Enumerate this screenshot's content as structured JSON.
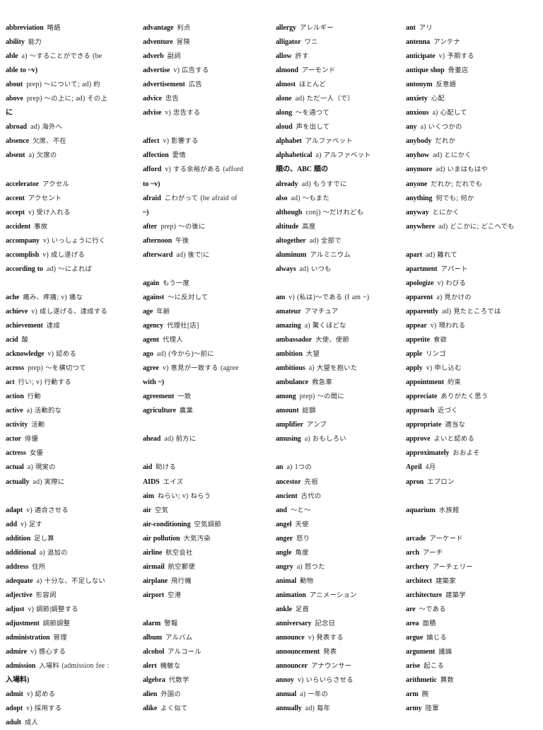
{
  "document": {
    "title": "English-Japanese Vocabulary List",
    "page_kind": "scanned-dictionary-page",
    "column_count": 4
  },
  "columns": [
    {
      "id": "column-1",
      "entries": [
        {
          "headword": "abbreviation",
          "gloss": "略語"
        },
        {
          "headword": "ability",
          "gloss": "能力"
        },
        {
          "headword": "able",
          "gloss": "a) ～することができる (be"
        },
        {
          "headword": "able to ~v)",
          "gloss": ""
        },
        {
          "headword": "about",
          "gloss": "prep) ～について; ad) 約"
        },
        {
          "headword": "above",
          "gloss": "prep) ～の上に; ad) その上"
        },
        {
          "headword": "に",
          "gloss": ""
        },
        {
          "headword": "abroad",
          "gloss": "ad) 海外へ"
        },
        {
          "headword": "absence",
          "gloss": "欠席、不在"
        },
        {
          "headword": "absent",
          "gloss": "a) 欠席の"
        },
        {
          "headword": "",
          "gloss": ""
        },
        {
          "headword": "accelerator",
          "gloss": "アクセル"
        },
        {
          "headword": "accent",
          "gloss": "アクセント"
        },
        {
          "headword": "accept",
          "gloss": "v) 受け入れる"
        },
        {
          "headword": "accident",
          "gloss": "事故"
        },
        {
          "headword": "accompany",
          "gloss": "v) いっしょうに行く"
        },
        {
          "headword": "accomplish",
          "gloss": "v) 成し遂げる"
        },
        {
          "headword": "according to",
          "gloss": "ad) ～によれば"
        },
        {
          "headword": "",
          "gloss": ""
        },
        {
          "headword": "ache",
          "gloss": "痛み、疼痛; v) 痛な"
        },
        {
          "headword": "achieve",
          "gloss": "v) 成し遂げる、達成する"
        },
        {
          "headword": "achievement",
          "gloss": "達成"
        },
        {
          "headword": "acid",
          "gloss": "酸"
        },
        {
          "headword": "acknowledge",
          "gloss": "v) 認める"
        },
        {
          "headword": "across",
          "gloss": "prep) ～を横切つて"
        },
        {
          "headword": "act",
          "gloss": "行い; v) 行動する"
        },
        {
          "headword": "action",
          "gloss": "行動"
        },
        {
          "headword": "active",
          "gloss": "a) 活動的な"
        },
        {
          "headword": "activity",
          "gloss": "活動"
        },
        {
          "headword": "actor",
          "gloss": "俳優"
        },
        {
          "headword": "actress",
          "gloss": "女優"
        },
        {
          "headword": "actual",
          "gloss": "a) 現実の"
        },
        {
          "headword": "actually",
          "gloss": "ad) 実際に"
        },
        {
          "headword": "",
          "gloss": ""
        },
        {
          "headword": "adapt",
          "gloss": "v) 適合させる"
        },
        {
          "headword": "add",
          "gloss": "v) 足す"
        },
        {
          "headword": "addition",
          "gloss": "足し算"
        },
        {
          "headword": "additional",
          "gloss": "a) 追加の"
        },
        {
          "headword": "address",
          "gloss": "住所"
        },
        {
          "headword": "adequate",
          "gloss": "a) 十分な、不足しない"
        },
        {
          "headword": "adjective",
          "gloss": "形容詞"
        },
        {
          "headword": "adjust",
          "gloss": "v) 調節|調整する"
        },
        {
          "headword": "adjustment",
          "gloss": "調節調整"
        },
        {
          "headword": "administration",
          "gloss": "管理"
        },
        {
          "headword": "admire",
          "gloss": "v) 感心する"
        },
        {
          "headword": "admission",
          "gloss": "入場料 (admission fee :"
        },
        {
          "headword": "入場料)",
          "gloss": ""
        },
        {
          "headword": "admit",
          "gloss": "v) 認める"
        },
        {
          "headword": "adopt",
          "gloss": "v) 採用する"
        },
        {
          "headword": "adult",
          "gloss": "成人"
        }
      ]
    },
    {
      "id": "column-2",
      "entries": [
        {
          "headword": "advantage",
          "gloss": "利点"
        },
        {
          "headword": "adventure",
          "gloss": "冒険"
        },
        {
          "headword": "adverb",
          "gloss": "副詞"
        },
        {
          "headword": "advertise",
          "gloss": "v) 広告する"
        },
        {
          "headword": "advertisement",
          "gloss": "広告"
        },
        {
          "headword": "advice",
          "gloss": "忠告"
        },
        {
          "headword": "advise",
          "gloss": "v) 忠告する"
        },
        {
          "headword": "",
          "gloss": ""
        },
        {
          "headword": "affect",
          "gloss": "v) 影響する"
        },
        {
          "headword": "affection",
          "gloss": "愛情"
        },
        {
          "headword": "afford",
          "gloss": "v) する余裕がある (afford"
        },
        {
          "headword": "to ~v)",
          "gloss": ""
        },
        {
          "headword": "afraid",
          "gloss": "こわがって (be afraid of"
        },
        {
          "headword": "~)",
          "gloss": ""
        },
        {
          "headword": "after",
          "gloss": "prep) ～の後に"
        },
        {
          "headword": "afternoon",
          "gloss": "午後"
        },
        {
          "headword": "afterward",
          "gloss": "ad) 後で|に"
        },
        {
          "headword": "",
          "gloss": ""
        },
        {
          "headword": "again",
          "gloss": "もう一度"
        },
        {
          "headword": "against",
          "gloss": "～に反対して"
        },
        {
          "headword": "age",
          "gloss": "年齢"
        },
        {
          "headword": "agency",
          "gloss": "代理社[店]"
        },
        {
          "headword": "agent",
          "gloss": "代理人"
        },
        {
          "headword": "ago",
          "gloss": "ad) (今から)～前に"
        },
        {
          "headword": "agree",
          "gloss": "v) 意見が一致する (agree"
        },
        {
          "headword": "with ~)",
          "gloss": ""
        },
        {
          "headword": "agreement",
          "gloss": "一致"
        },
        {
          "headword": "agriculture",
          "gloss": "農業"
        },
        {
          "headword": "",
          "gloss": ""
        },
        {
          "headword": "ahead",
          "gloss": "ad) 前方に"
        },
        {
          "headword": "",
          "gloss": ""
        },
        {
          "headword": "aid",
          "gloss": "助ける"
        },
        {
          "headword": "AIDS",
          "gloss": "エイズ"
        },
        {
          "headword": "aim",
          "gloss": "ねらい; v) ねらう"
        },
        {
          "headword": "air",
          "gloss": "空気"
        },
        {
          "headword": "air-conditioning",
          "gloss": "空気調節"
        },
        {
          "headword": "air pollution",
          "gloss": "大気汚染"
        },
        {
          "headword": "airline",
          "gloss": "航空会社"
        },
        {
          "headword": "airmail",
          "gloss": "航空郵便"
        },
        {
          "headword": "airplane",
          "gloss": "飛行機"
        },
        {
          "headword": "airport",
          "gloss": "空港"
        },
        {
          "headword": "",
          "gloss": ""
        },
        {
          "headword": "alarm",
          "gloss": "警報"
        },
        {
          "headword": "album",
          "gloss": "アルバム"
        },
        {
          "headword": "alcohol",
          "gloss": "アルコール"
        },
        {
          "headword": "alert",
          "gloss": "機敏な"
        },
        {
          "headword": "algebra",
          "gloss": "代数学"
        },
        {
          "headword": "alien",
          "gloss": "外国の"
        },
        {
          "headword": "alike",
          "gloss": "よく似て"
        }
      ]
    },
    {
      "id": "column-3",
      "entries": [
        {
          "headword": "allergy",
          "gloss": "アレルギー"
        },
        {
          "headword": "alligator",
          "gloss": "ワニ"
        },
        {
          "headword": "allow",
          "gloss": "許す"
        },
        {
          "headword": "almond",
          "gloss": "アーモンド"
        },
        {
          "headword": "almost",
          "gloss": "ほとんど"
        },
        {
          "headword": "alone",
          "gloss": "ad) ただ一人（で）"
        },
        {
          "headword": "along",
          "gloss": "～を通つて"
        },
        {
          "headword": "aloud",
          "gloss": "声を出して"
        },
        {
          "headword": "alphabet",
          "gloss": "アルファベット"
        },
        {
          "headword": "alphabetical",
          "gloss": "a) アルファベット"
        },
        {
          "headword": "順の、ABC 順の",
          "gloss": ""
        },
        {
          "headword": "already",
          "gloss": "ad) もうすでに"
        },
        {
          "headword": "also",
          "gloss": "ad) ～もまた"
        },
        {
          "headword": "although",
          "gloss": "conj) ～だけれども"
        },
        {
          "headword": "altitude",
          "gloss": "高度"
        },
        {
          "headword": "altogether",
          "gloss": "ad) 全部で"
        },
        {
          "headword": "aluminum",
          "gloss": "アルミニウム"
        },
        {
          "headword": "always",
          "gloss": "ad) いつも"
        },
        {
          "headword": "",
          "gloss": ""
        },
        {
          "headword": "am",
          "gloss": "v) (私は)～である (I am ~)"
        },
        {
          "headword": "amateur",
          "gloss": "アマチュア"
        },
        {
          "headword": "amazing",
          "gloss": "a) 驚くほどな"
        },
        {
          "headword": "ambassador",
          "gloss": "大使、使節"
        },
        {
          "headword": "ambition",
          "gloss": "大望"
        },
        {
          "headword": "ambitious",
          "gloss": "a) 大望を抱いた"
        },
        {
          "headword": "ambulance",
          "gloss": "救急車"
        },
        {
          "headword": "among",
          "gloss": "prep) ～の間に"
        },
        {
          "headword": "amount",
          "gloss": "総額"
        },
        {
          "headword": "amplifier",
          "gloss": "アンプ"
        },
        {
          "headword": "amusing",
          "gloss": "a) おもしろい"
        },
        {
          "headword": "",
          "gloss": ""
        },
        {
          "headword": "an",
          "gloss": "a) 1つの"
        },
        {
          "headword": "ancestor",
          "gloss": "先祖"
        },
        {
          "headword": "ancient",
          "gloss": "古代の"
        },
        {
          "headword": "and",
          "gloss": "～と～"
        },
        {
          "headword": "angel",
          "gloss": "天使"
        },
        {
          "headword": "anger",
          "gloss": "怒り"
        },
        {
          "headword": "angle",
          "gloss": "角度"
        },
        {
          "headword": "angry",
          "gloss": "a) 怒つた"
        },
        {
          "headword": "animal",
          "gloss": "動物"
        },
        {
          "headword": "animation",
          "gloss": "アニメーション"
        },
        {
          "headword": "ankle",
          "gloss": "足首"
        },
        {
          "headword": "anniversary",
          "gloss": "記念日"
        },
        {
          "headword": "announce",
          "gloss": "v) 発表する"
        },
        {
          "headword": "announcement",
          "gloss": "発表"
        },
        {
          "headword": "announcer",
          "gloss": "アナウンサー"
        },
        {
          "headword": "annoy",
          "gloss": "v) いらいらさせる"
        },
        {
          "headword": "annual",
          "gloss": "a) 一年の"
        },
        {
          "headword": "annually",
          "gloss": "ad) 毎年"
        }
      ]
    },
    {
      "id": "column-4",
      "entries": [
        {
          "headword": "ant",
          "gloss": "アリ"
        },
        {
          "headword": "antenna",
          "gloss": "アンテナ"
        },
        {
          "headword": "anticipate",
          "gloss": "v) 予期する"
        },
        {
          "headword": "antique shop",
          "gloss": "骨董店"
        },
        {
          "headword": "antonym",
          "gloss": "反意語"
        },
        {
          "headword": "anxiety",
          "gloss": "心配"
        },
        {
          "headword": "anxious",
          "gloss": "a) 心配して"
        },
        {
          "headword": "any",
          "gloss": "a) いくつかの"
        },
        {
          "headword": "anybody",
          "gloss": "だれか"
        },
        {
          "headword": "anyhow",
          "gloss": "ad) とにかく"
        },
        {
          "headword": "anymore",
          "gloss": "ad) いまはもはや"
        },
        {
          "headword": "anyone",
          "gloss": "だれか; だれでも"
        },
        {
          "headword": "anything",
          "gloss": "何でも; 何か"
        },
        {
          "headword": "anyway",
          "gloss": "とにかく"
        },
        {
          "headword": "anywhere",
          "gloss": "ad) どこかに; どこへでも"
        },
        {
          "headword": "",
          "gloss": ""
        },
        {
          "headword": "apart",
          "gloss": "ad) 離れて"
        },
        {
          "headword": "apartment",
          "gloss": "アパート"
        },
        {
          "headword": "apologize",
          "gloss": "v) わびる"
        },
        {
          "headword": "apparent",
          "gloss": "a) 見かけの"
        },
        {
          "headword": "apparently",
          "gloss": "ad) 見たところでは"
        },
        {
          "headword": "appear",
          "gloss": "v) 現われる"
        },
        {
          "headword": "appetite",
          "gloss": "食欲"
        },
        {
          "headword": "apple",
          "gloss": "リンゴ"
        },
        {
          "headword": "apply",
          "gloss": "v) 申し込む"
        },
        {
          "headword": "appointment",
          "gloss": "約束"
        },
        {
          "headword": "appreciate",
          "gloss": "ありがたく思う"
        },
        {
          "headword": "approach",
          "gloss": "近づく"
        },
        {
          "headword": "appropriate",
          "gloss": "適当な"
        },
        {
          "headword": "approve",
          "gloss": "よいと認める"
        },
        {
          "headword": "approximately",
          "gloss": "おおよそ"
        },
        {
          "headword": "April",
          "gloss": "4月"
        },
        {
          "headword": "apron",
          "gloss": "エプロン"
        },
        {
          "headword": "",
          "gloss": ""
        },
        {
          "headword": "aquarium",
          "gloss": "水族館"
        },
        {
          "headword": "",
          "gloss": ""
        },
        {
          "headword": "arcade",
          "gloss": "アーケード"
        },
        {
          "headword": "arch",
          "gloss": "アーチ"
        },
        {
          "headword": "archery",
          "gloss": "アーチェリー"
        },
        {
          "headword": "architect",
          "gloss": "建築家"
        },
        {
          "headword": "architecture",
          "gloss": "建築学"
        },
        {
          "headword": "are",
          "gloss": "～である"
        },
        {
          "headword": "area",
          "gloss": "面積"
        },
        {
          "headword": "argue",
          "gloss": "論じる"
        },
        {
          "headword": "argument",
          "gloss": "議論"
        },
        {
          "headword": "arise",
          "gloss": "起こる"
        },
        {
          "headword": "arithmetic",
          "gloss": "算数"
        },
        {
          "headword": "arm",
          "gloss": "腕"
        },
        {
          "headword": "army",
          "gloss": "陸軍"
        }
      ]
    }
  ]
}
